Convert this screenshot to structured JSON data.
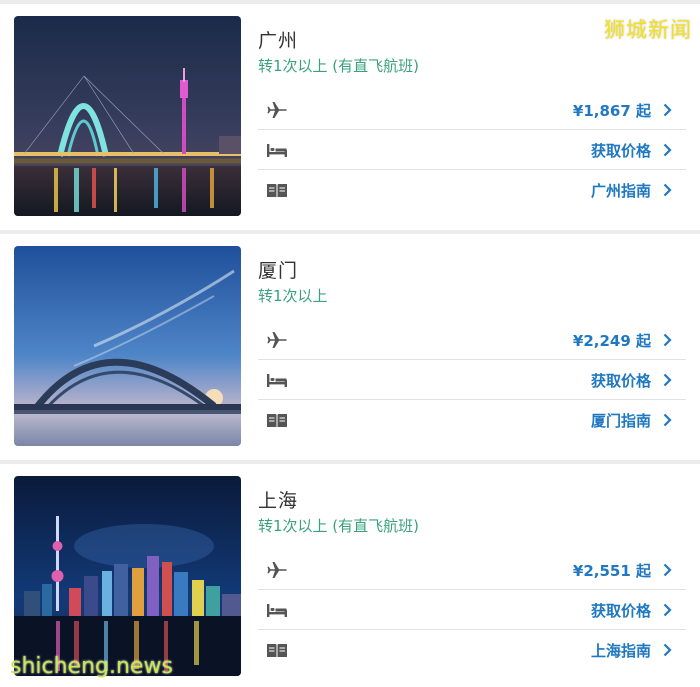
{
  "watermarks": {
    "top_right": "狮城新闻",
    "bottom_left": "shicheng.news"
  },
  "colors": {
    "accent_blue": "#1f78c1",
    "transfer_green": "#3aa17e",
    "icon_gray": "#555555"
  },
  "destinations": [
    {
      "city": "广州",
      "transfer": "转1次以上 (有直飞航班)",
      "image": "guangzhou-bridge-night-photo",
      "rows": [
        {
          "icon": "airplane-icon",
          "value": "¥1,867 起"
        },
        {
          "icon": "bed-icon",
          "value": "获取价格"
        },
        {
          "icon": "book-icon",
          "value": "广州指南"
        }
      ]
    },
    {
      "city": "厦门",
      "transfer": "转1次以上",
      "image": "xiamen-arch-bridge-dusk-photo",
      "rows": [
        {
          "icon": "airplane-icon",
          "value": "¥2,249 起"
        },
        {
          "icon": "bed-icon",
          "value": "获取价格"
        },
        {
          "icon": "book-icon",
          "value": "厦门指南"
        }
      ]
    },
    {
      "city": "上海",
      "transfer": "转1次以上 (有直飞航班)",
      "image": "shanghai-skyline-night-photo",
      "rows": [
        {
          "icon": "airplane-icon",
          "value": "¥2,551 起"
        },
        {
          "icon": "bed-icon",
          "value": "获取价格"
        },
        {
          "icon": "book-icon",
          "value": "上海指南"
        }
      ]
    }
  ]
}
